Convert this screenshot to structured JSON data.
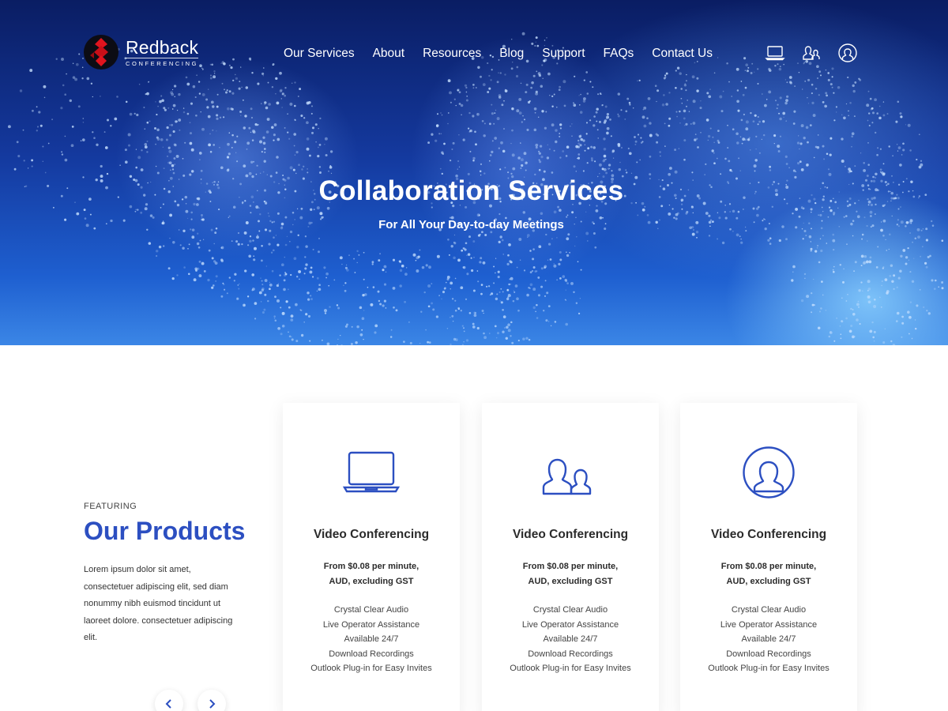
{
  "brand": {
    "name": "Redback",
    "tagline": "CONFERENCING"
  },
  "nav": {
    "items": [
      "Our Services",
      "About",
      "Resources",
      "Blog",
      "Support",
      "FAQs",
      "Contact Us"
    ],
    "icons": [
      "laptop-icon",
      "users-icon",
      "user-icon"
    ]
  },
  "hero": {
    "title": "Collaboration Services",
    "subtitle": "For All Your Day-to-day Meetings"
  },
  "featured": {
    "label": "FEATURING",
    "title": "Our Products",
    "description": "Lorem ipsum dolor sit amet, consectetuer adipiscing elit, sed diam nonummy nibh euismod tincidunt ut laoreet dolore. consectetuer adipiscing elit.",
    "prev": "‹",
    "next": "›"
  },
  "products": [
    {
      "icon": "laptop-icon",
      "title": "Video Conferencing",
      "price_line1": "From $0.08 per minute,",
      "price_line2": "AUD, excluding GST",
      "features": [
        "Crystal Clear Audio",
        "Live Operator Assistance",
        "Available 24/7",
        "Download Recordings",
        "Outlook Plug-in for Easy Invites"
      ]
    },
    {
      "icon": "users-icon",
      "title": "Video Conferencing",
      "price_line1": "From $0.08 per minute,",
      "price_line2": "AUD, excluding GST",
      "features": [
        "Crystal Clear Audio",
        "Live Operator Assistance",
        "Available 24/7",
        "Download Recordings",
        "Outlook Plug-in for Easy Invites"
      ]
    },
    {
      "icon": "user-circle-icon",
      "title": "Video Conferencing",
      "price_line1": "From $0.08 per minute,",
      "price_line2": "AUD, excluding GST",
      "features": [
        "Crystal Clear Audio",
        "Live Operator Assistance",
        "Available 24/7",
        "Download Recordings",
        "Outlook Plug-in for Easy Invites"
      ]
    }
  ],
  "colors": {
    "accent": "#2c4fc1",
    "hero_dark": "#0a1d63",
    "hero_light": "#3b86e6",
    "logo_red": "#e0141e"
  }
}
